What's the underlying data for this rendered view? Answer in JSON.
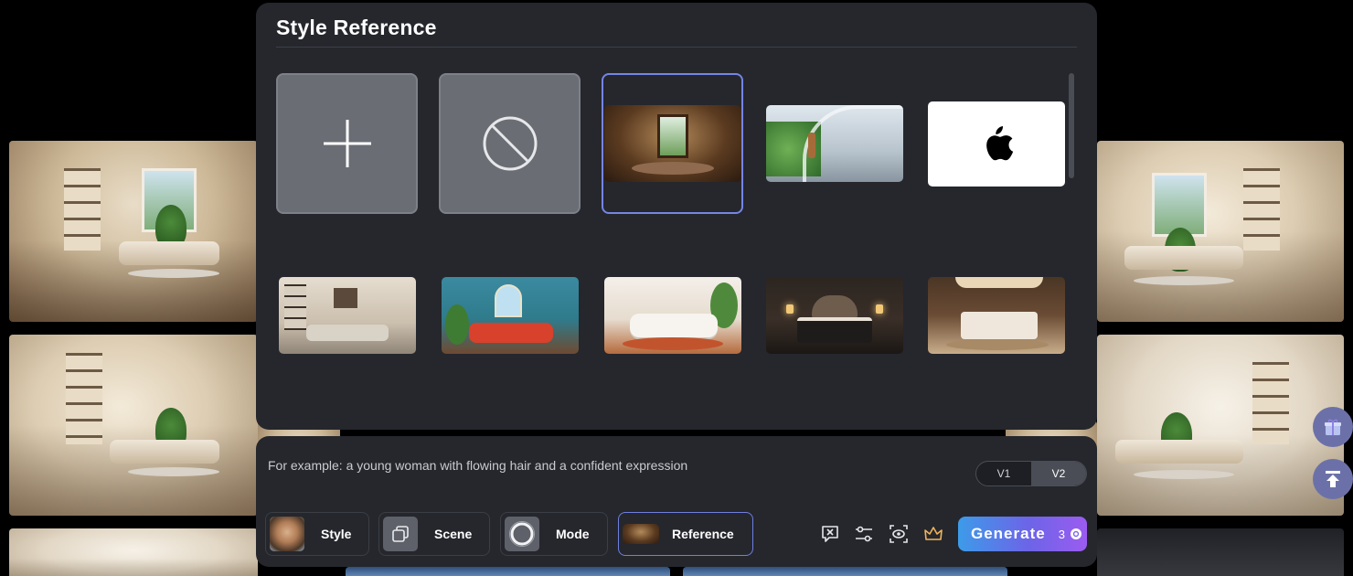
{
  "modal": {
    "title": "Style Reference",
    "tiles": [
      {
        "kind": "add",
        "icon": "plus-icon"
      },
      {
        "kind": "none",
        "icon": "ban-icon"
      },
      {
        "kind": "image",
        "style": "colonial-living-room",
        "selected": true
      },
      {
        "kind": "image",
        "style": "futuristic-corridor"
      },
      {
        "kind": "image",
        "style": "apple-logo"
      },
      {
        "kind": "image",
        "style": "beige-living-room"
      },
      {
        "kind": "image",
        "style": "boho-red-sofa"
      },
      {
        "kind": "image",
        "style": "white-boho-living-room"
      },
      {
        "kind": "image",
        "style": "dark-bedroom"
      },
      {
        "kind": "image",
        "style": "luxury-bedroom"
      }
    ]
  },
  "prompt": {
    "placeholder": "For example: a young woman with flowing hair and a confident expression",
    "value": ""
  },
  "version": {
    "options": [
      "V1",
      "V2"
    ],
    "selected": "V2"
  },
  "chips": {
    "style": "Style",
    "scene": "Scene",
    "mode": "Mode",
    "reference": "Reference"
  },
  "tools": [
    "clear-prompt-icon",
    "settings-sliders-icon",
    "preview-eye-icon",
    "crown-icon"
  ],
  "generate": {
    "label": "Generate",
    "cost": "3"
  },
  "colors": {
    "panel": "#25272d",
    "accent": "#6f7fe0",
    "generate_start": "#3d9be9",
    "generate_end": "#9b5cf0"
  }
}
